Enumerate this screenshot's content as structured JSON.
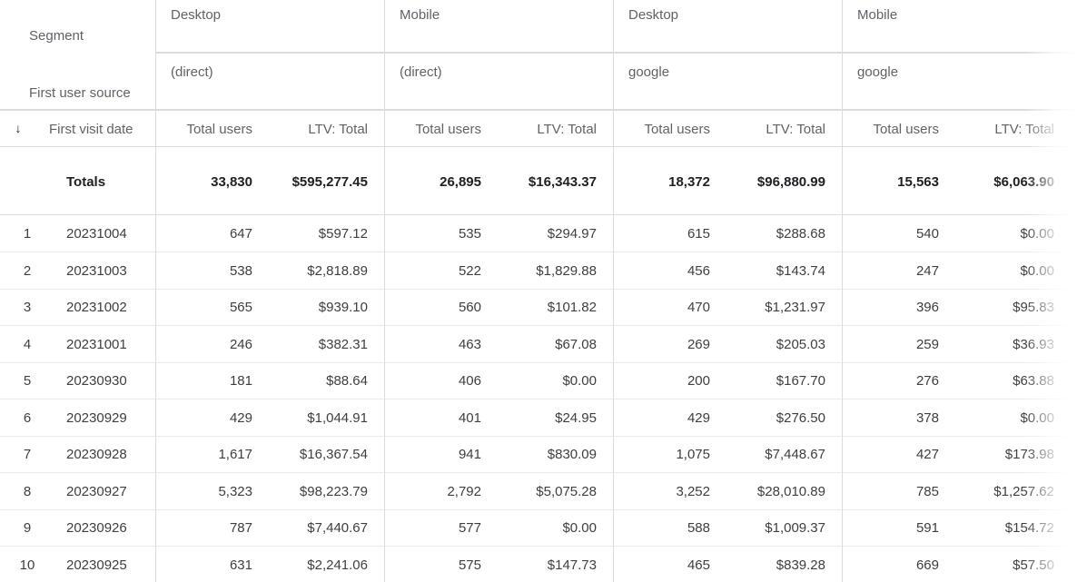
{
  "report": {
    "segment_label": "Segment",
    "source_label": "First user source",
    "dimension_label": "First visit date",
    "sort_icon": "arrow-down-icon",
    "column_groups": [
      {
        "segment": "Desktop",
        "source": "(direct)",
        "metric1": "Total users",
        "metric2": "LTV: Total"
      },
      {
        "segment": "Mobile",
        "source": "(direct)",
        "metric1": "Total users",
        "metric2": "LTV: Total"
      },
      {
        "segment": "Desktop",
        "source": "google",
        "metric1": "Total users",
        "metric2": "LTV: Total"
      },
      {
        "segment": "Mobile",
        "source": "google",
        "metric1": "Total users",
        "metric2": "LTV: Total"
      }
    ],
    "totals": {
      "label": "Totals",
      "values": [
        "33,830",
        "$595,277.45",
        "26,895",
        "$16,343.37",
        "18,372",
        "$96,880.99",
        "15,563",
        "$6,063.90"
      ]
    },
    "rows": [
      {
        "index": "1",
        "date": "20231004",
        "values": [
          "647",
          "$597.12",
          "535",
          "$294.97",
          "615",
          "$288.68",
          "540",
          "$0.00"
        ]
      },
      {
        "index": "2",
        "date": "20231003",
        "values": [
          "538",
          "$2,818.89",
          "522",
          "$1,829.88",
          "456",
          "$143.74",
          "247",
          "$0.00"
        ]
      },
      {
        "index": "3",
        "date": "20231002",
        "values": [
          "565",
          "$939.10",
          "560",
          "$101.82",
          "470",
          "$1,231.97",
          "396",
          "$95.83"
        ]
      },
      {
        "index": "4",
        "date": "20231001",
        "values": [
          "246",
          "$382.31",
          "463",
          "$67.08",
          "269",
          "$205.03",
          "259",
          "$36.93"
        ]
      },
      {
        "index": "5",
        "date": "20230930",
        "values": [
          "181",
          "$88.64",
          "406",
          "$0.00",
          "200",
          "$167.70",
          "276",
          "$63.88"
        ]
      },
      {
        "index": "6",
        "date": "20230929",
        "values": [
          "429",
          "$1,044.91",
          "401",
          "$24.95",
          "429",
          "$276.50",
          "378",
          "$0.00"
        ]
      },
      {
        "index": "7",
        "date": "20230928",
        "values": [
          "1,617",
          "$16,367.54",
          "941",
          "$830.09",
          "1,075",
          "$7,448.67",
          "427",
          "$173.98"
        ]
      },
      {
        "index": "8",
        "date": "20230927",
        "values": [
          "5,323",
          "$98,223.79",
          "2,792",
          "$5,075.28",
          "3,252",
          "$28,010.89",
          "785",
          "$1,257.62"
        ]
      },
      {
        "index": "9",
        "date": "20230926",
        "values": [
          "787",
          "$7,440.67",
          "577",
          "$0.00",
          "588",
          "$1,009.37",
          "591",
          "$154.72"
        ]
      },
      {
        "index": "10",
        "date": "20230925",
        "values": [
          "631",
          "$2,241.06",
          "575",
          "$147.73",
          "465",
          "$839.28",
          "669",
          "$57.50"
        ]
      }
    ]
  }
}
